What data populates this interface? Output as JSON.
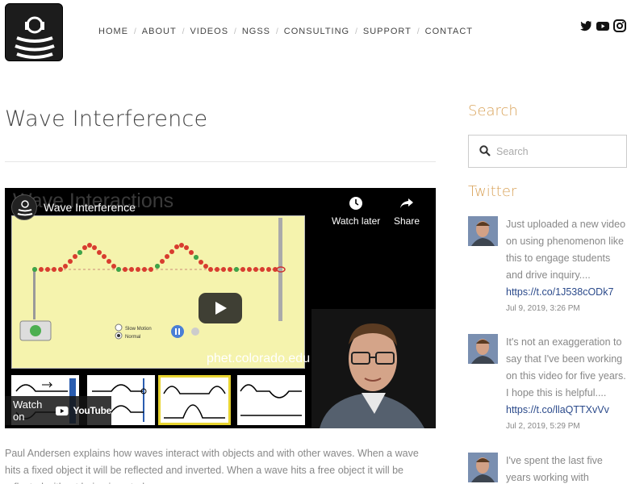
{
  "nav": {
    "items": [
      "HOME",
      "ABOUT",
      "VIDEOS",
      "NGSS",
      "CONSULTING",
      "SUPPORT",
      "CONTACT"
    ],
    "separator": "/"
  },
  "social": [
    "twitter-icon",
    "youtube-icon",
    "instagram-icon"
  ],
  "page": {
    "title": "Wave Interference"
  },
  "video": {
    "bg_title": "Wave Interactions",
    "title": "Wave Interference",
    "watch_later": "Watch later",
    "share": "Share",
    "sim_opt_slow": "Slow Motion",
    "sim_opt_normal": "Normal",
    "url": "phet.colorado.edu",
    "watch_on": "Watch on",
    "youtube": "YouTube"
  },
  "description": "Paul Andersen explains how waves interact with objects and with other waves. When a wave hits a fixed object it will be reflected and inverted. When a wave hits a free object it will be reflected without being inverted.",
  "sidebar": {
    "search_heading": "Search",
    "search_placeholder": "Search",
    "twitter_heading": "Twitter",
    "tweets": [
      {
        "text": "Just uploaded a new video on using phenomenon like this to engage students and drive inquiry....",
        "link": "https://t.co/1J538cODk7",
        "date": "Jul 9, 2019, 3:26 PM"
      },
      {
        "text": "It's not an exaggeration to say that I've been working on this video for five years. I hope this is helpful....",
        "link": "https://t.co/llaQTTXvVv",
        "date": "Jul 2, 2019, 5:29 PM"
      },
      {
        "text": "I've spent the last five years working with",
        "link": "",
        "date": ""
      }
    ]
  },
  "colors": {
    "accent": "#d9a35a",
    "link": "#2b4a8b",
    "sim_bg": "#f5f3ad"
  }
}
